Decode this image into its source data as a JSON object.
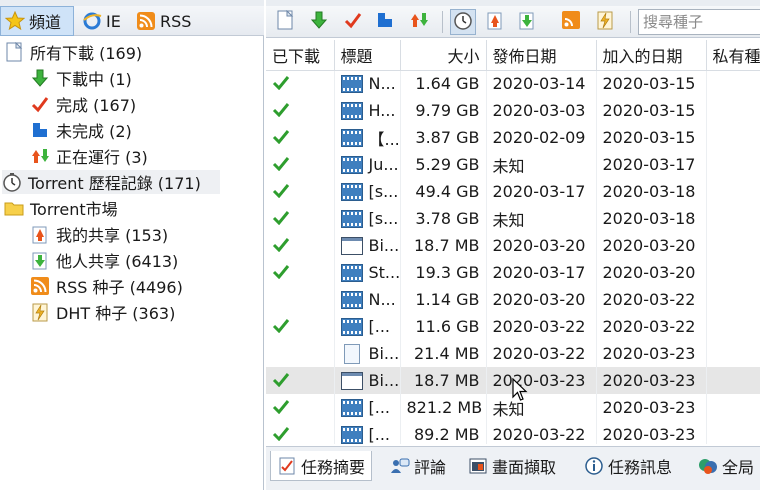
{
  "left_tabs": [
    {
      "label": "頻道",
      "icon": "star-icon",
      "active": true
    },
    {
      "label": "IE",
      "icon": "ie-icon",
      "active": false
    },
    {
      "label": "RSS",
      "icon": "rss-icon",
      "active": false
    }
  ],
  "tree": [
    {
      "label": "所有下載 (169)",
      "icon": "page-icon"
    },
    {
      "label": "下載中 (1)",
      "icon": "arrow-down-icon"
    },
    {
      "label": "完成 (167)",
      "icon": "checkmark-icon"
    },
    {
      "label": "未完成 (2)",
      "icon": "blue-bar-icon"
    },
    {
      "label": "正在運行 (3)",
      "icon": "up-down-arrows-icon"
    },
    {
      "label": "Torrent 歷程記錄 (171)",
      "icon": "clock-icon"
    },
    {
      "label": "Torrent市場",
      "icon": "folder-icon"
    },
    {
      "label": "我的共享 (153)",
      "icon": "share-up-icon"
    },
    {
      "label": "他人共享 (6413)",
      "icon": "share-down-icon"
    },
    {
      "label": "RSS 种子 (4496)",
      "icon": "rss-feed-icon"
    },
    {
      "label": "DHT 种子 (363)",
      "icon": "dht-icon"
    }
  ],
  "search": {
    "placeholder": "搜尋種子"
  },
  "table": {
    "headers": [
      "已下載",
      "標題",
      "大小",
      "發佈日期",
      "加入的日期",
      "私有種"
    ],
    "rows": [
      {
        "done": true,
        "icon": "film",
        "title": "N...",
        "size": "1.64 GB",
        "published": "2020-03-14",
        "added": "2020-03-15"
      },
      {
        "done": true,
        "icon": "film",
        "title": "H...",
        "size": "9.79 GB",
        "published": "2020-03-03",
        "added": "2020-03-15"
      },
      {
        "done": true,
        "icon": "film",
        "title": "【...",
        "size": "3.87 GB",
        "published": "2020-02-09",
        "added": "2020-03-15"
      },
      {
        "done": true,
        "icon": "film",
        "title": "Ju...",
        "size": "5.29 GB",
        "published": "未知",
        "added": "2020-03-17"
      },
      {
        "done": true,
        "icon": "film",
        "title": "[s...",
        "size": "49.4 GB",
        "published": "2020-03-17",
        "added": "2020-03-18"
      },
      {
        "done": true,
        "icon": "film",
        "title": "[s...",
        "size": "3.78 GB",
        "published": "未知",
        "added": "2020-03-18"
      },
      {
        "done": true,
        "icon": "window",
        "title": "Bi...",
        "size": "18.7 MB",
        "published": "2020-03-20",
        "added": "2020-03-20"
      },
      {
        "done": true,
        "icon": "film",
        "title": "St...",
        "size": "19.3 GB",
        "published": "2020-03-17",
        "added": "2020-03-20"
      },
      {
        "done": false,
        "icon": "film",
        "title": "N...",
        "size": "1.14 GB",
        "published": "2020-03-20",
        "added": "2020-03-22"
      },
      {
        "done": true,
        "icon": "film",
        "title": "[...",
        "size": "11.6 GB",
        "published": "2020-03-22",
        "added": "2020-03-22"
      },
      {
        "done": false,
        "icon": "doc",
        "title": "Bi...",
        "size": "21.4 MB",
        "published": "2020-03-22",
        "added": "2020-03-23"
      },
      {
        "done": true,
        "icon": "window",
        "title": "Bi...",
        "size": "18.7 MB",
        "published": "2020-03-23",
        "added": "2020-03-23",
        "selected": true
      },
      {
        "done": true,
        "icon": "film",
        "title": "[...",
        "size": "821.2 MB",
        "published": "未知",
        "added": "2020-03-23"
      },
      {
        "done": true,
        "icon": "film",
        "title": "[...",
        "size": "89.2 MB",
        "published": "2020-03-22",
        "added": "2020-03-23"
      }
    ]
  },
  "bottom_tabs": [
    {
      "label": "任務摘要",
      "icon": "summary-icon",
      "active": true
    },
    {
      "label": "評論",
      "icon": "comment-icon",
      "active": false
    },
    {
      "label": "畫面擷取",
      "icon": "screenshot-icon",
      "active": false
    },
    {
      "label": "任務訊息",
      "icon": "info-icon",
      "active": false
    },
    {
      "label": "全局",
      "icon": "global-icon",
      "active": false
    }
  ],
  "toolbar": {
    "buttons": [
      "all-downloads-icon",
      "downloading-icon",
      "completed-icon",
      "incomplete-icon",
      "running-icon",
      "history-icon",
      "my-share-icon",
      "others-share-icon",
      "rss-seeds-icon",
      "dht-seeds-icon"
    ]
  },
  "colors": {
    "check": "#2e9e2e",
    "selection": "#cfe3f8",
    "film": "#3f7fbf"
  }
}
